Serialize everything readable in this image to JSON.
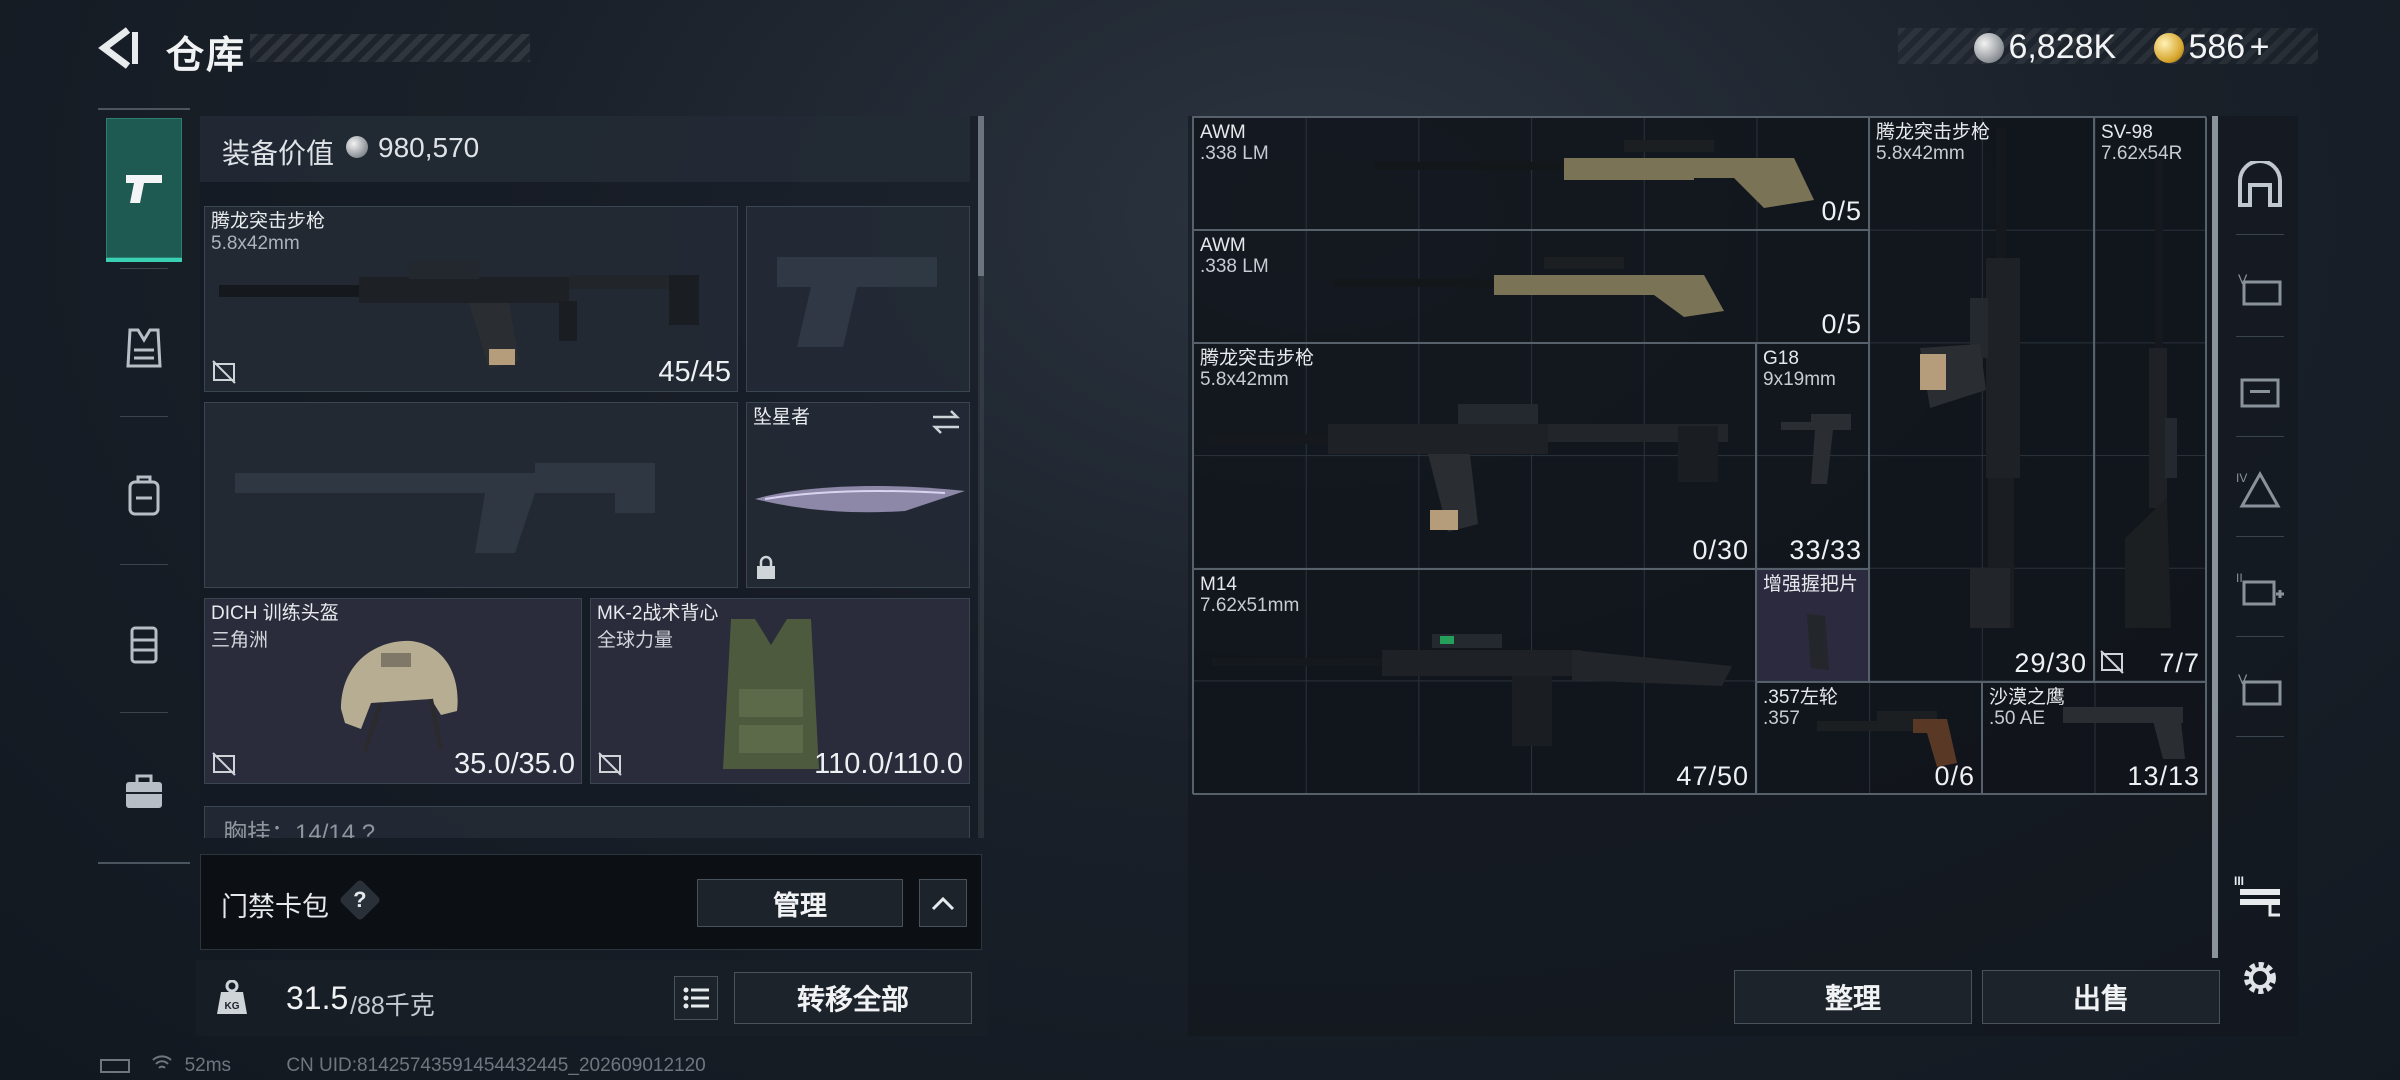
{
  "header": {
    "title": "仓库"
  },
  "currency": {
    "silver": "6,828K",
    "gold": "586",
    "add_symbol": "+"
  },
  "loadout": {
    "value_label": "装备价值",
    "value": "980,570",
    "primary": {
      "name": "腾龙突击步枪",
      "ammo": "5.8x42mm",
      "count": "45/45"
    },
    "melee": {
      "name": "坠星者"
    },
    "helmet": {
      "name": "DICH 训练头盔",
      "faction": "三角洲",
      "durability": "35.0/35.0"
    },
    "armor": {
      "name": "MK-2战术背心",
      "faction": "全球力量",
      "durability": "110.0/110.0"
    },
    "chest_rig_peek": "胸挂：14/14 ?"
  },
  "access_card": {
    "label": "门禁卡包",
    "help": "?",
    "manage_label": "管理"
  },
  "weight": {
    "current": "31.5",
    "max": "/88千克",
    "transfer_all_label": "转移全部"
  },
  "stash": {
    "items": [
      {
        "name": "AWM",
        "sub": ".338 LM",
        "count": "0/5"
      },
      {
        "name": "AWM",
        "sub": ".338 LM",
        "count": "0/5"
      },
      {
        "name": "腾龙突击步枪",
        "sub": "5.8x42mm",
        "count": "0/30"
      },
      {
        "name": "G18",
        "sub": "9x19mm",
        "count": "33/33"
      },
      {
        "name": "M14",
        "sub": "7.62x51mm",
        "count": "47/50"
      },
      {
        "name": "增强握把片",
        "sub": "",
        "count": ""
      },
      {
        "name": ".357左轮",
        "sub": ".357",
        "count": "0/6"
      },
      {
        "name": "沙漠之鹰",
        "sub": ".50 AE",
        "count": "13/13"
      },
      {
        "name": "腾龙突击步枪",
        "sub": "5.8x42mm",
        "count": "29/30"
      },
      {
        "name": "SV-98",
        "sub": "7.62x54R",
        "count": "7/7"
      }
    ],
    "sort_label": "整理",
    "sell_label": "出售"
  },
  "status_bar": {
    "ping": "52ms",
    "uid": "CN UID:8142574359145443244​5_202609012120"
  },
  "colors": {
    "accent": "#3ad0b4",
    "active_tab": "#1e5a52"
  }
}
